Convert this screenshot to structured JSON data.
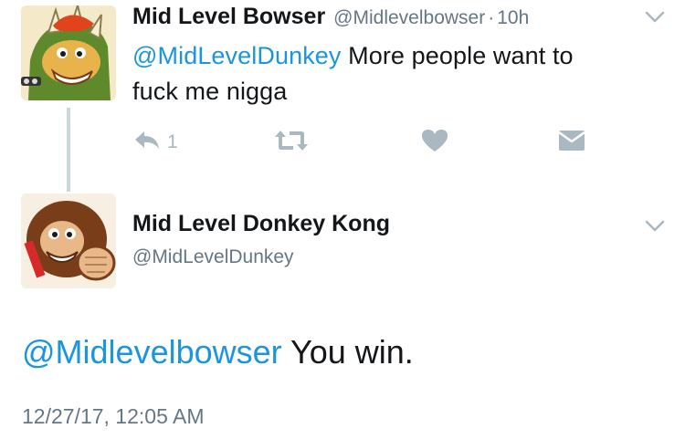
{
  "tweet1": {
    "name": "Mid Level Bowser",
    "handle": "@Midlevelbowser",
    "dot": "·",
    "time": "10h",
    "mention": "@MidLevelDunkey",
    "text_line1": " More people want to",
    "text_line2": "fuck me nigga",
    "reply_count": "1",
    "avatar_icon": "bowser-avatar"
  },
  "tweet2": {
    "name": "Mid Level Donkey Kong",
    "handle": "@MidLevelDunkey",
    "mention": "@Midlevelbowser",
    "text": " You win.",
    "timestamp": "12/27/17, 12:05 AM",
    "avatar_icon": "donkey-kong-avatar"
  },
  "colors": {
    "link": "#1b95e0",
    "text": "#14171a",
    "secondary": "#657786",
    "icon": "#aab8c2"
  }
}
